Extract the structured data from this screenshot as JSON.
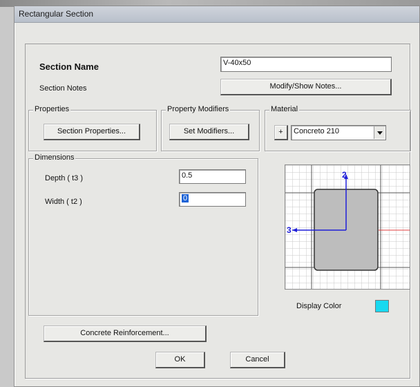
{
  "dialog": {
    "title": "Rectangular Section"
  },
  "section": {
    "name_label": "Section Name",
    "name_value": "V-40x50",
    "notes_label": "Section Notes",
    "notes_button": "Modify/Show Notes..."
  },
  "properties": {
    "legend": "Properties",
    "button": "Section Properties..."
  },
  "modifiers": {
    "legend": "Property Modifiers",
    "button": "Set Modifiers..."
  },
  "material": {
    "legend": "Material",
    "plus": "+",
    "selected": "Concreto 210"
  },
  "dimensions": {
    "legend": "Dimensions",
    "depth_label": "Depth ( t3 )",
    "depth_value": "0.5",
    "width_label": "Width ( t2 )",
    "width_value": "0"
  },
  "preview": {
    "axis2_label": "2",
    "axis3_label": "3"
  },
  "display_color": {
    "label": "Display Color",
    "color": "#19d9f0"
  },
  "buttons": {
    "reinforcement": "Concrete Reinforcement...",
    "ok": "OK",
    "cancel": "Cancel"
  },
  "icons": {
    "dropdown": "chevron-down-icon",
    "section_preview": "rectangular-section-diagram"
  }
}
